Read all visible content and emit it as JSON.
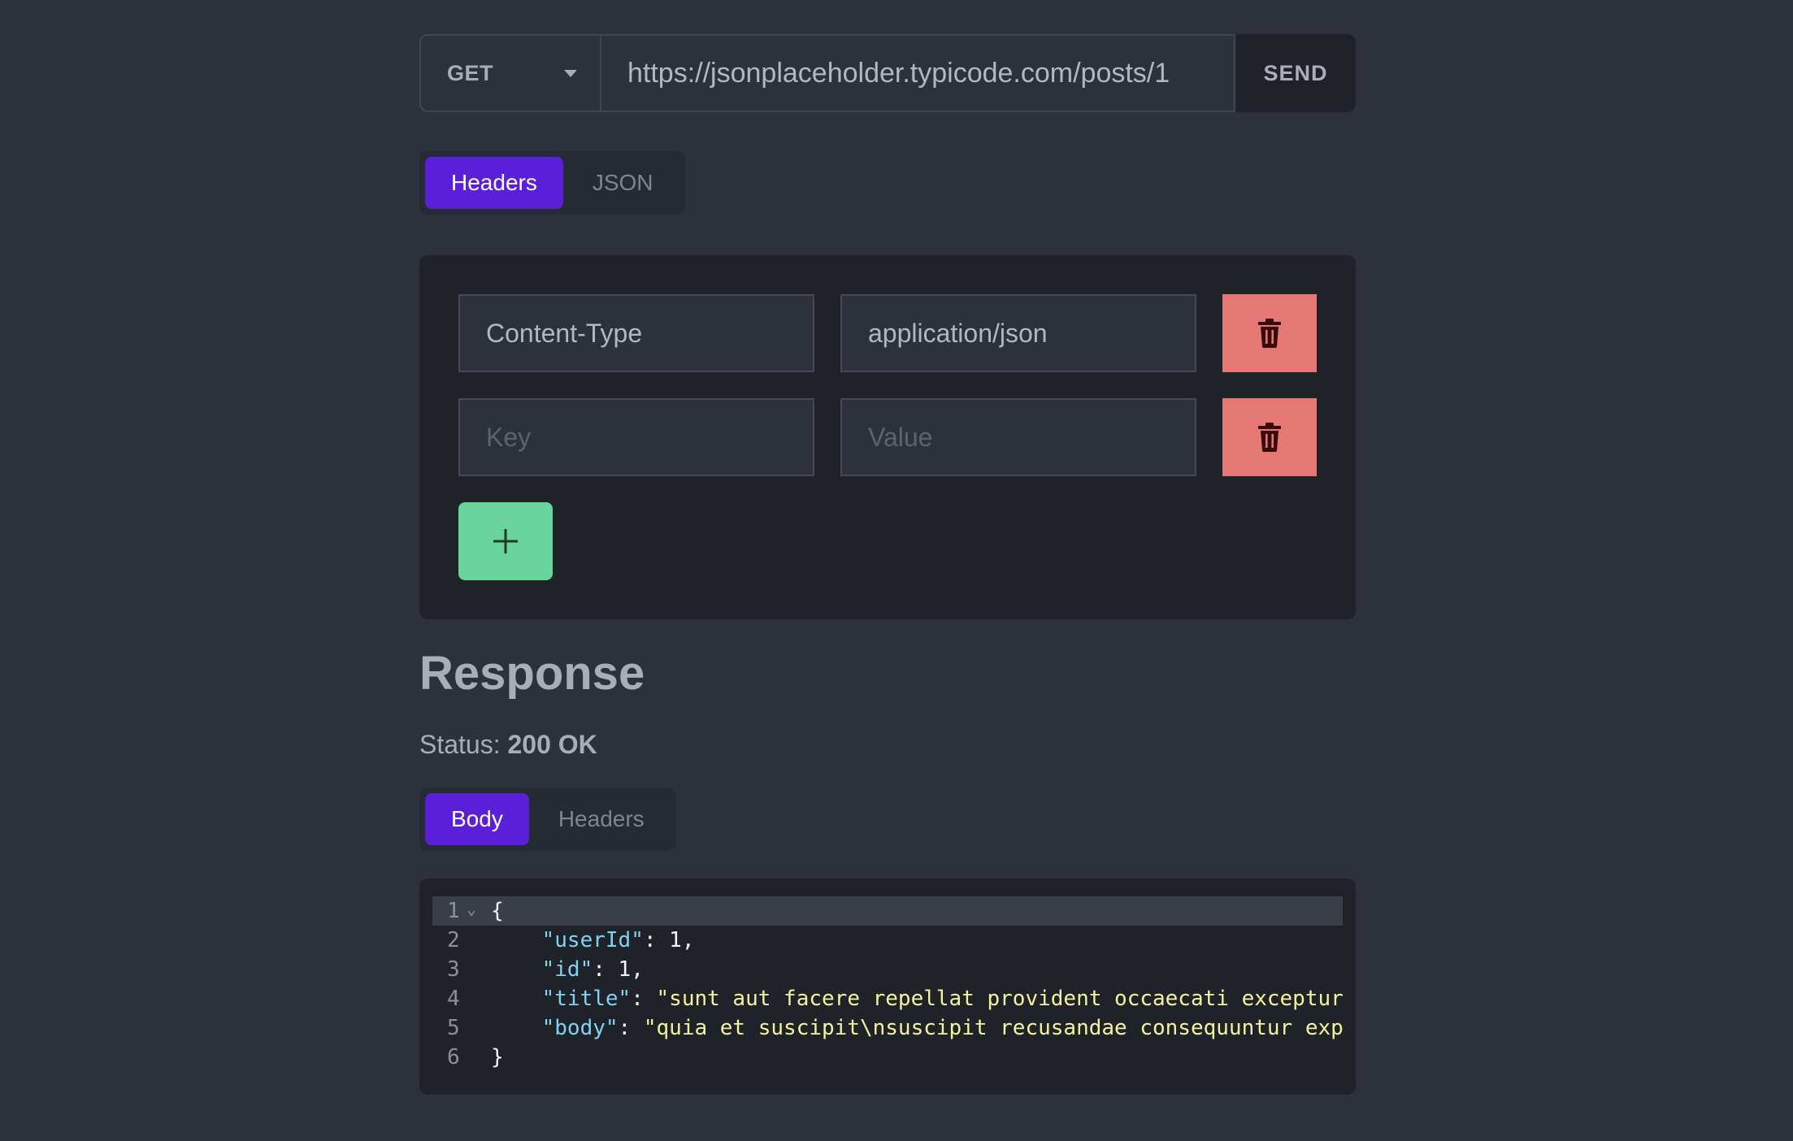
{
  "request": {
    "method": "GET",
    "url": "https://jsonplaceholder.typicode.com/posts/1",
    "send_label": "SEND"
  },
  "request_tabs": [
    {
      "label": "Headers",
      "active": true
    },
    {
      "label": "JSON",
      "active": false
    }
  ],
  "headers": [
    {
      "key": "Content-Type",
      "value": "application/json",
      "key_placeholder": "Key",
      "value_placeholder": "Value"
    },
    {
      "key": "",
      "value": "",
      "key_placeholder": "Key",
      "value_placeholder": "Value"
    }
  ],
  "add_label": "+",
  "response": {
    "title": "Response",
    "status_label": "Status:",
    "status_value": "200 OK"
  },
  "response_tabs": [
    {
      "label": "Body",
      "active": true
    },
    {
      "label": "Headers",
      "active": false
    }
  ],
  "code": {
    "lines": [
      {
        "num": "1",
        "fold": "⌄",
        "parts": [
          {
            "t": "{",
            "c": "punc"
          }
        ]
      },
      {
        "num": "2",
        "parts": [
          {
            "t": "    ",
            "c": "punc"
          },
          {
            "t": "\"userId\"",
            "c": "key"
          },
          {
            "t": ": 1,",
            "c": "punc"
          }
        ]
      },
      {
        "num": "3",
        "parts": [
          {
            "t": "    ",
            "c": "punc"
          },
          {
            "t": "\"id\"",
            "c": "key"
          },
          {
            "t": ": 1,",
            "c": "punc"
          }
        ]
      },
      {
        "num": "4",
        "parts": [
          {
            "t": "    ",
            "c": "punc"
          },
          {
            "t": "\"title\"",
            "c": "key"
          },
          {
            "t": ": ",
            "c": "punc"
          },
          {
            "t": "\"sunt aut facere repellat provident occaecati exceptur",
            "c": "str"
          }
        ]
      },
      {
        "num": "5",
        "parts": [
          {
            "t": "    ",
            "c": "punc"
          },
          {
            "t": "\"body\"",
            "c": "key"
          },
          {
            "t": ": ",
            "c": "punc"
          },
          {
            "t": "\"quia et suscipit\\nsuscipit recusandae consequuntur exp",
            "c": "str"
          }
        ]
      },
      {
        "num": "6",
        "parts": [
          {
            "t": "}",
            "c": "punc"
          }
        ]
      }
    ]
  },
  "colors": {
    "background": "#2d313c",
    "panel": "#1f2229",
    "accent": "#5b1fd9",
    "delete": "#e57874",
    "add": "#68d39b",
    "json_key": "#7fd3f0",
    "json_string": "#f3f39d"
  },
  "icons": {
    "method_caret": "caret-down-icon",
    "delete": "trash-icon",
    "add": "plus-icon",
    "fold": "chevron-down-icon"
  }
}
